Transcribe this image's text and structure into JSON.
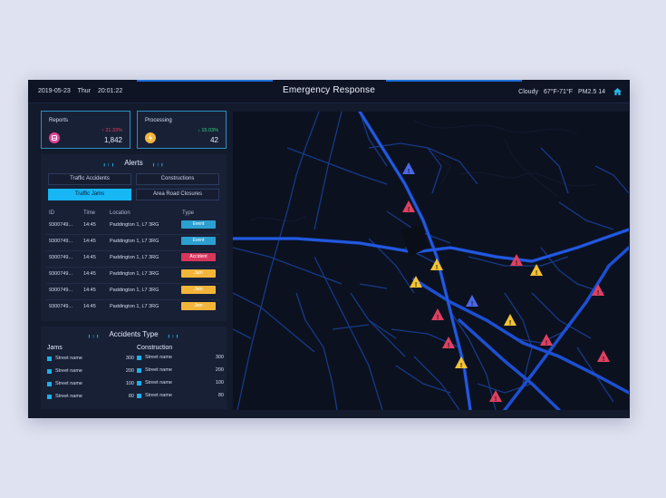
{
  "header": {
    "date": "2019-05-23",
    "weekday": "Thur",
    "time": "20:01:22",
    "title": "Emergency Response",
    "weather": "Cloudy",
    "temperature": "67°F-71°F",
    "air_quality": "PM2.5 14"
  },
  "stats": {
    "reports": {
      "label": "Reports",
      "delta": "↑ 21.33%",
      "value": "1,842",
      "color": "#e8409a",
      "icon": "inbox-icon"
    },
    "processing": {
      "label": "Processing",
      "delta": "↓ 15.03%",
      "value": "42",
      "color": "#f4b73b",
      "icon": "bolt-icon"
    }
  },
  "alerts": {
    "title": "Alerts",
    "tabs": [
      "Traffic Accidents",
      "Constructions",
      "Traffic Jams",
      "Area Road Closures"
    ],
    "active_tab": "Traffic Jams",
    "columns": [
      "ID",
      "Time",
      "Location",
      "Type"
    ],
    "rows": [
      {
        "id": "9300749...",
        "time": "14:45",
        "location": "Paddington 1, L7 3RG",
        "type": "Event",
        "color": "#2b9fd0"
      },
      {
        "id": "9300749...",
        "time": "14:45",
        "location": "Paddington 1, L7 3RG",
        "type": "Event",
        "color": "#2b9fd0"
      },
      {
        "id": "9300749...",
        "time": "14:45",
        "location": "Paddington 1, L7 3RG",
        "type": "Accident",
        "color": "#d8365d"
      },
      {
        "id": "9300749...",
        "time": "14:45",
        "location": "Paddington 1, L7 3RG",
        "type": "Jam",
        "color": "#f2b53a"
      },
      {
        "id": "9300749...",
        "time": "14:45",
        "location": "Paddington 1, L7 3RG",
        "type": "Jam",
        "color": "#f2b53a"
      },
      {
        "id": "9300749...",
        "time": "14:45",
        "location": "Paddington 1, L7 3RG",
        "type": "Jam",
        "color": "#f2b53a"
      }
    ]
  },
  "accidents_type": {
    "title": "Accidents Type",
    "jams": {
      "heading": "Jams",
      "items": [
        {
          "name": "Street name",
          "value": "300"
        },
        {
          "name": "Street name",
          "value": "200"
        },
        {
          "name": "Street name",
          "value": "100"
        },
        {
          "name": "Street name",
          "value": "80"
        }
      ]
    },
    "construction": {
      "heading": "Construction",
      "items": [
        {
          "name": "Street name",
          "value": "300"
        },
        {
          "name": "Street name",
          "value": "200"
        },
        {
          "name": "Street name",
          "value": "100"
        },
        {
          "name": "Street name",
          "value": "80"
        }
      ]
    }
  },
  "map": {
    "markers": [
      {
        "kind": "closure",
        "color": "#4a68e6"
      },
      {
        "kind": "accident",
        "color": "#e0405f"
      },
      {
        "kind": "jam",
        "color": "#f3c332"
      },
      {
        "kind": "jam",
        "color": "#f3c332"
      },
      {
        "kind": "accident",
        "color": "#e0405f"
      },
      {
        "kind": "jam",
        "color": "#f3c332"
      },
      {
        "kind": "closure",
        "color": "#4a68e6"
      },
      {
        "kind": "accident",
        "color": "#e0405f"
      },
      {
        "kind": "jam",
        "color": "#f3c332"
      },
      {
        "kind": "accident",
        "color": "#e0405f"
      },
      {
        "kind": "accident",
        "color": "#e0405f"
      },
      {
        "kind": "jam",
        "color": "#f3c332"
      },
      {
        "kind": "accident",
        "color": "#e0405f"
      },
      {
        "kind": "accident",
        "color": "#e0405f"
      },
      {
        "kind": "accident",
        "color": "#e0405f"
      }
    ]
  }
}
